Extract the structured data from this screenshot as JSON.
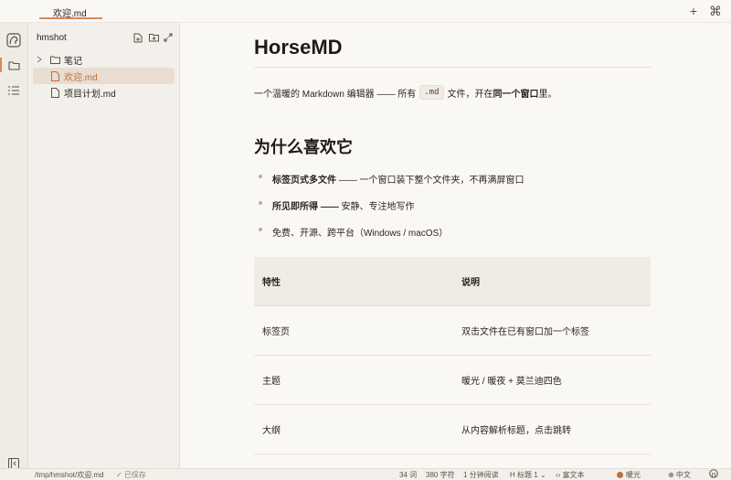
{
  "tabs": [
    {
      "label": "欢迎.md",
      "active": true
    }
  ],
  "tab_actions": {
    "new": "+",
    "command": "⌘"
  },
  "activity_bar": {
    "items": [
      {
        "icon": "horse-logo-icon"
      },
      {
        "icon": "folder-icon",
        "active": true
      },
      {
        "icon": "outline-list-icon"
      }
    ],
    "bottom_icon": "collapse-sidebar-icon"
  },
  "sidebar": {
    "title": "hmshot",
    "actions": [
      "new-file-icon",
      "new-folder-icon",
      "expand-icon"
    ],
    "tree": [
      {
        "label": "笔记",
        "type": "folder",
        "expanded": false
      },
      {
        "label": "欢迎.md",
        "type": "file",
        "selected": true
      },
      {
        "label": "项目计划.md",
        "type": "file",
        "selected": false
      }
    ]
  },
  "doc": {
    "title": "HorseMD",
    "intro": {
      "part1": "一个温暖的 Markdown 编辑器 —— 所有",
      "code": ".md",
      "part2": "文件，开在",
      "bold": "同一个窗口",
      "part3": "里。"
    },
    "h2": "为什么喜欢它",
    "list": [
      {
        "bold": "标签页式多文件",
        "text": " —— 一个窗口装下整个文件夹，不再满屏窗口"
      },
      {
        "bold": "所见即所得 ——",
        "text": " 安静、专注地写作"
      },
      {
        "bold": "",
        "text": "免费、开源、跨平台（Windows / macOS）"
      }
    ],
    "table": {
      "headers": [
        "特性",
        "说明"
      ],
      "rows": [
        [
          "标签页",
          "双击文件在已有窗口加一个标签"
        ],
        [
          "主题",
          "暖光 / 暖夜 + 莫兰迪四色"
        ],
        [
          "大纲",
          "从内容解析标题，点击跳转"
        ]
      ]
    }
  },
  "status": {
    "path": "/tmp/hmshot/欢迎.md",
    "saved": "✓ 已保存",
    "words": "34 词",
    "chars": "380 字符",
    "read_time": "1 分钟阅读",
    "heading": "H  标题 1 ⌄",
    "mode": "‹› 富文本",
    "theme": "暖光",
    "theme_color": "#b8733f",
    "lang": "⊕ 中文",
    "github_icon": "github-icon"
  },
  "colors": {
    "accent": "#d9875a",
    "selected_bg": "#e8ddd0",
    "selected_text": "#c76a3a"
  }
}
